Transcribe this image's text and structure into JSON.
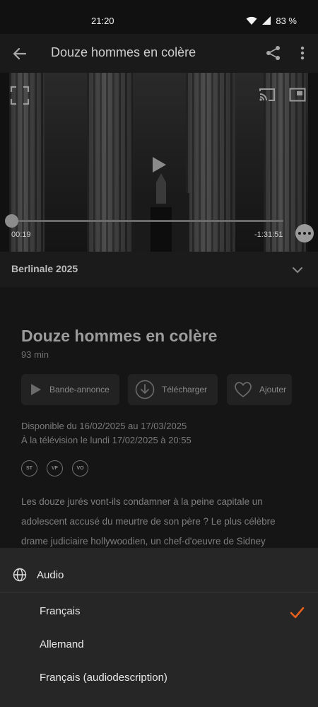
{
  "status_bar": {
    "time": "21:20",
    "battery": "83 %"
  },
  "app_bar": {
    "title": "Douze hommes en colère"
  },
  "player": {
    "elapsed": "00:19",
    "remaining": "-1:31:51",
    "progress": 0.003
  },
  "festival": {
    "label": "Berlinale 2025"
  },
  "movie": {
    "title": "Douze hommes en colère",
    "duration": "93 min",
    "actions": {
      "trailer": "Bande-annonce",
      "download": "Télécharger",
      "add": "Ajouter"
    },
    "availability": "Disponible du 16/02/2025 au 17/03/2025",
    "broadcast": "À la télévision le lundi 17/02/2025 à  20:55",
    "badges": [
      "ST",
      "VF",
      "VO"
    ],
    "synopsis": "Les douze jurés vont-ils condamner à la peine capitale un adolescent accusé du meurtre de son père ? Le plus célèbre drame judiciaire hollywoodien, un chef-d'oeuvre de Sidney"
  },
  "audio_sheet": {
    "title": "Audio",
    "options": [
      {
        "label": "Français",
        "selected": true
      },
      {
        "label": "Allemand",
        "selected": false
      },
      {
        "label": "Français (audiodescription)",
        "selected": false
      }
    ],
    "accent_color": "#e8601c"
  }
}
